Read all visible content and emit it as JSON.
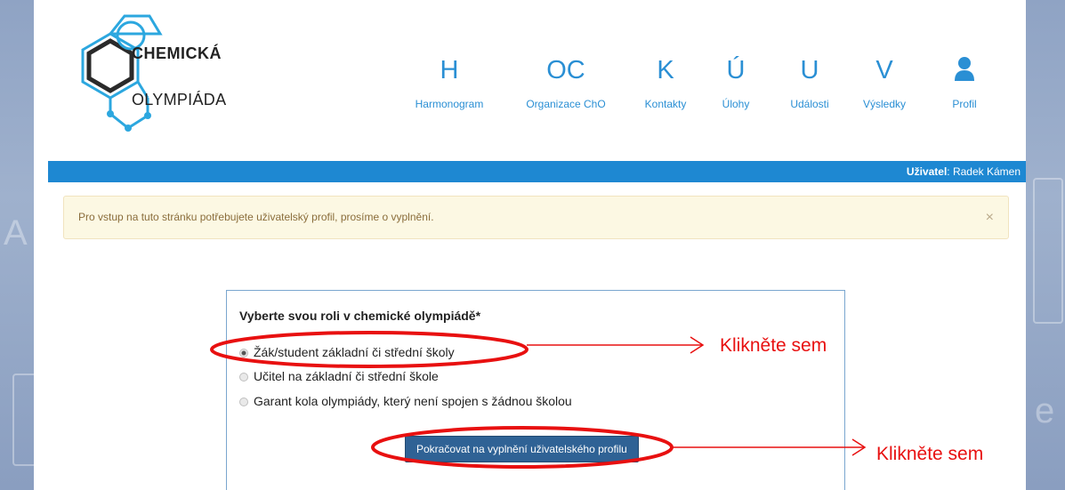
{
  "logo": {
    "line1": "CHEMICKÁ",
    "line2": "OLYMPIÁDA"
  },
  "nav": [
    {
      "letter": "H",
      "label": "Harmonogram"
    },
    {
      "letter": "OC",
      "label": "Organizace ChO"
    },
    {
      "letter": "K",
      "label": "Kontakty"
    },
    {
      "letter": "Ú",
      "label": "Úlohy"
    },
    {
      "letter": "U",
      "label": "Události"
    },
    {
      "letter": "V",
      "label": "Výsledky"
    },
    {
      "icon": "user-icon",
      "label": "Profil"
    }
  ],
  "user_bar": {
    "label": "Uživatel",
    "name": ": Radek Kámen"
  },
  "alert": {
    "text": "Pro vstup na tuto stránku potřebujete uživatelský profil, prosíme o vyplnění.",
    "close": "×"
  },
  "form": {
    "title": "Vyberte svou roli v chemické olympiádě*",
    "options": [
      {
        "label": "Žák/student základní či střední školy",
        "checked": true
      },
      {
        "label": "Učitel na základní či střední škole",
        "checked": false
      },
      {
        "label": "Garant kola olympiády, který není spojen s žádnou školou",
        "checked": false
      }
    ],
    "submit": "Pokračovat na vyplnění uživatelského profilu"
  },
  "annotations": {
    "first": "Klikněte sem",
    "second": "Klikněte sem"
  },
  "colors": {
    "accent": "#1e88d2",
    "button": "#2f6295",
    "annotation": "#e81010"
  }
}
